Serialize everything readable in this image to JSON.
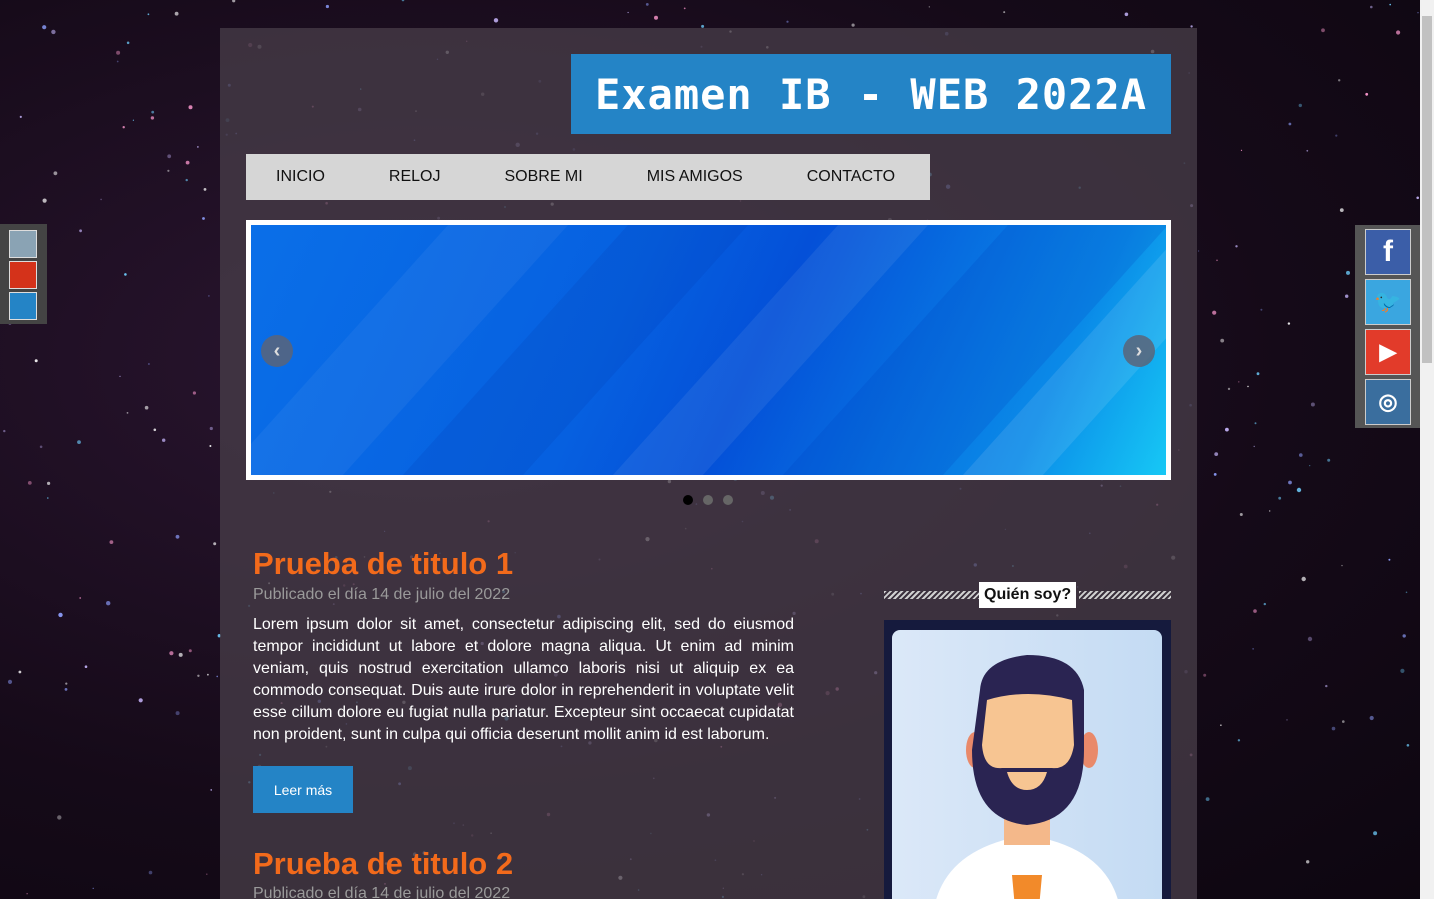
{
  "header": {
    "title": "Examen IB - WEB 2022A"
  },
  "nav": {
    "items": [
      "INICIO",
      "RELOJ",
      "SOBRE MI",
      "MIS AMIGOS",
      "CONTACTO"
    ]
  },
  "slider": {
    "prev_icon": "chevron-left-icon",
    "next_icon": "chevron-right-icon",
    "active_index": 0,
    "count": 3
  },
  "posts": [
    {
      "title": "Prueba de titulo 1",
      "date": "Publicado el día 14 de julio del 2022",
      "body": "Lorem ipsum dolor sit amet, consectetur adipiscing elit, sed do eiusmod tempor incididunt ut labore et dolore magna aliqua. Ut enim ad minim veniam, quis nostrud exercitation ullamco laboris nisi ut aliquip ex ea commodo consequat. Duis aute irure dolor in reprehenderit in voluptate velit esse cillum dolore eu fugiat nulla pariatur. Excepteur sint occaecat cupidatat non proident, sunt in culpa qui officia deserunt mollit anim id est laborum.",
      "button": "Leer más"
    },
    {
      "title": "Prueba de titulo 2",
      "date": "Publicado el día 14 de julio del 2022"
    }
  ],
  "sidebar": {
    "heading": "Quién soy?"
  },
  "color_swatches": [
    "#8aa3b4",
    "#d4321a",
    "#2484c6"
  ],
  "social": [
    {
      "name": "facebook",
      "icon": "facebook-icon",
      "glyph": "f",
      "color": "#3b5ea8"
    },
    {
      "name": "twitter",
      "icon": "twitter-icon",
      "glyph": "🐦",
      "color": "#3aa6e0"
    },
    {
      "name": "youtube",
      "icon": "youtube-icon",
      "glyph": "▶",
      "color": "#e23b2a"
    },
    {
      "name": "instagram",
      "icon": "instagram-icon",
      "glyph": "◎",
      "color": "#3a6e9e"
    }
  ]
}
